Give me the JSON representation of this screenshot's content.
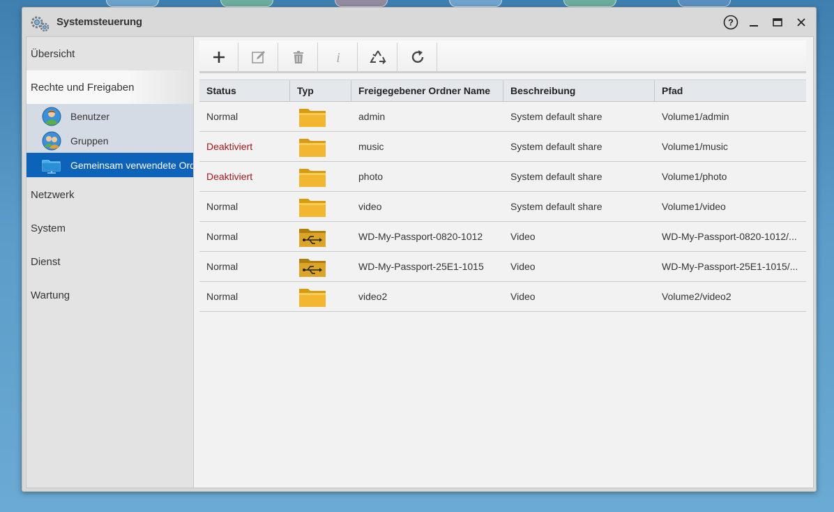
{
  "window": {
    "title": "Systemsteuerung"
  },
  "sidebar": {
    "items": [
      {
        "label": "Übersicht"
      },
      {
        "label": "Rechte und Freigaben"
      },
      {
        "label": "Netzwerk"
      },
      {
        "label": "System"
      },
      {
        "label": "Dienst"
      },
      {
        "label": "Wartung"
      }
    ],
    "subitems": [
      {
        "label": "Benutzer",
        "icon": "user-icon"
      },
      {
        "label": "Gruppen",
        "icon": "group-icon"
      },
      {
        "label": "Gemeinsam verwendete Ord",
        "icon": "shared-folder-icon"
      }
    ]
  },
  "toolbar": {
    "buttons": [
      "add-icon",
      "edit-icon",
      "delete-icon",
      "info-icon",
      "recycle-icon",
      "refresh-icon"
    ]
  },
  "table": {
    "columns": [
      "Status",
      "Typ",
      "Freigegebener Ordner Name",
      "Beschreibung",
      "Pfad"
    ],
    "rows": [
      {
        "status": "Normal",
        "type": "folder-icon",
        "name": "admin",
        "desc": "System default share",
        "path": "Volume1/admin"
      },
      {
        "status": "Deaktiviert",
        "type": "folder-icon",
        "name": "music",
        "desc": "System default share",
        "path": "Volume1/music"
      },
      {
        "status": "Deaktiviert",
        "type": "folder-icon",
        "name": "photo",
        "desc": "System default share",
        "path": "Volume1/photo"
      },
      {
        "status": "Normal",
        "type": "folder-icon",
        "name": "video",
        "desc": "System default share",
        "path": "Volume1/video"
      },
      {
        "status": "Normal",
        "type": "usb-folder-icon",
        "name": "WD-My-Passport-0820-1012",
        "desc": "Video",
        "path": "WD-My-Passport-0820-1012/..."
      },
      {
        "status": "Normal",
        "type": "usb-folder-icon",
        "name": "WD-My-Passport-25E1-1015",
        "desc": "Video",
        "path": "WD-My-Passport-25E1-1015/..."
      },
      {
        "status": "Normal",
        "type": "folder-icon",
        "name": "video2",
        "desc": "Video",
        "path": "Volume2/video2"
      }
    ]
  },
  "colors": {
    "active": "#0c63b8",
    "disabled_status": "#a11818",
    "folder": "#f0b429"
  }
}
